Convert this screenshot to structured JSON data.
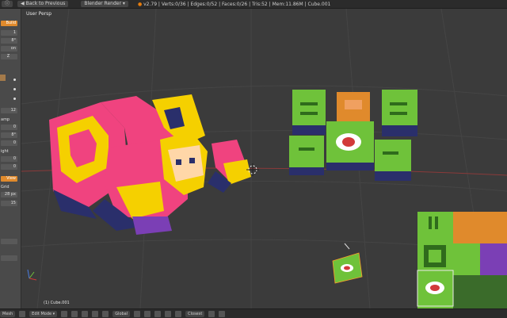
{
  "topbar": {
    "engine": "Blender Render",
    "back_label": "Back to Previous",
    "stats": "v2.79 | Verts:0/36 | Edges:0/52 | Faces:0/26 | Tris:52 | Mem:11.86M | Cube.001"
  },
  "viewport": {
    "title": "User Persp",
    "object_label": "(1) Cube.001"
  },
  "sidebar": {
    "build_label": "Build",
    "field_1": "1",
    "field_2": "8°",
    "field_3": "on",
    "field_4": "Z",
    "field_5": "12",
    "label_amp": "amp",
    "field_6": "0",
    "field_7": "8°",
    "field_8": "0",
    "label_right": "ight",
    "field_9": "0",
    "field_10": "0",
    "view_label": "View",
    "label_grid": "Grid",
    "field_11": "28 px",
    "field_12": "15"
  },
  "bottombar": {
    "left_label": "Mesh",
    "mode": "Edit Mode",
    "orientation": "Global",
    "snap": "Closest"
  },
  "colors": {
    "pink": "#f0437f",
    "yellow": "#f5d000",
    "navy": "#2a2f6b",
    "green": "#6fc23a",
    "dark_green": "#2f6b1c",
    "orange": "#e08a2c",
    "skin": "#ffd7a8"
  }
}
